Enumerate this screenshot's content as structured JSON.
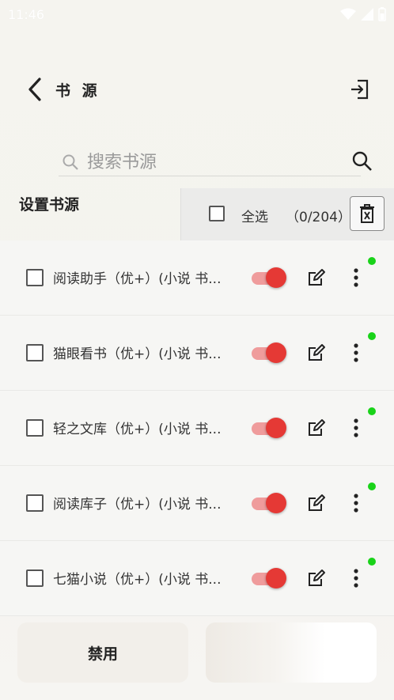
{
  "status_bar": {
    "time": "11:46"
  },
  "toolbar": {
    "title": "书 源"
  },
  "search": {
    "placeholder": "搜索书源"
  },
  "section": {
    "title": "设置书源"
  },
  "selection": {
    "label": "全选",
    "count": "（0/204）"
  },
  "sources": [
    {
      "name": "阅读助手（优+）(小说 书...",
      "enabled": true
    },
    {
      "name": "猫眼看书（优+）(小说 书...",
      "enabled": true
    },
    {
      "name": "轻之文库（优+）(小说 书...",
      "enabled": true
    },
    {
      "name": "阅读库子（优+）(小说 书...",
      "enabled": true
    },
    {
      "name": "七猫小说（优+）(小说 书...",
      "enabled": true
    }
  ],
  "bottom": {
    "disable_label": "禁用"
  },
  "colors": {
    "accent": "#e53935",
    "online_dot": "#19d319"
  }
}
